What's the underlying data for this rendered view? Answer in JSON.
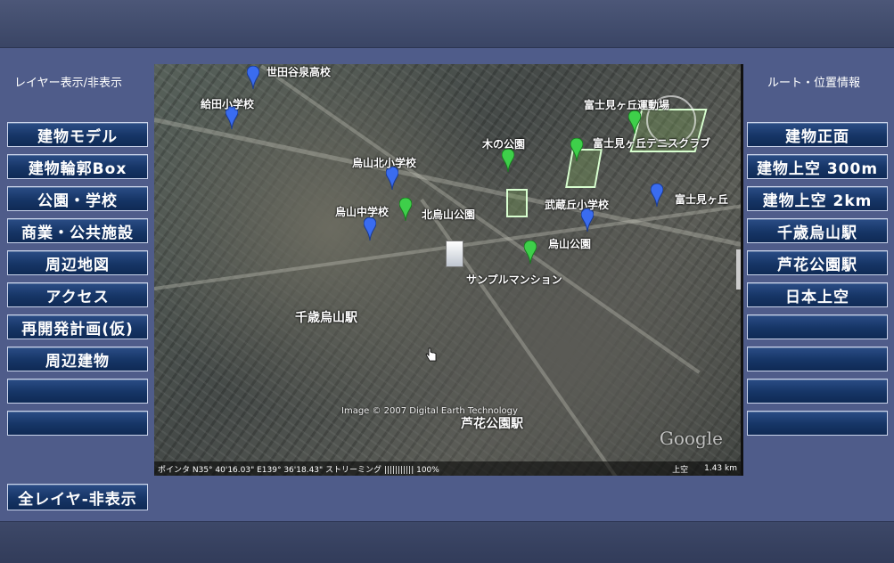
{
  "left_panel": {
    "title": "レイヤー表示/非表示",
    "buttons": [
      "建物モデル",
      "建物輪郭Box",
      "公園・学校",
      "商業・公共施設",
      "周辺地図",
      "アクセス",
      "再開発計画(仮)",
      "周辺建物",
      "",
      ""
    ],
    "hide_all": "全レイヤ-非表示"
  },
  "right_panel": {
    "title": "ルート・位置情報",
    "buttons": [
      "建物正面",
      "建物上空 300m",
      "建物上空 2km",
      "千歳烏山駅",
      "芦花公園駅",
      "日本上空",
      "",
      "",
      "",
      ""
    ]
  },
  "map": {
    "labels": {
      "setagaya_hs": "世田谷泉高校",
      "kyuden_es": "給田小学校",
      "fujimi_field": "富士見ヶ丘運動場",
      "kinokoen": "木の公園",
      "fujimi_tennis": "富士見ヶ丘テニスクラブ",
      "karasuyama_kita_es": "烏山北小学校",
      "musashigaoka_es": "武蔵丘小学校",
      "fujimi_right": "富士見ヶ丘",
      "karasuyama_ms": "烏山中学校",
      "kita_karasuyama_park": "北烏山公園",
      "karasuyama_park": "烏山公園",
      "sample_mansion": "サンプルマンション",
      "chitose_station": "千歳烏山駅",
      "roka_station": "芦花公園駅"
    },
    "copyright": "Image © 2007 Digital Earth Technology",
    "logo": "Google",
    "status_left": "ポインタ N35° 40'16.03\" E139° 36'18.43\" ストリーミング ||||||||||| 100%",
    "status_mode": "上空",
    "status_alt": "1.43 km",
    "colors": {
      "pin_blue": "#3a6cf0",
      "pin_green": "#3ecf4a",
      "button_bg": "#163566"
    }
  }
}
